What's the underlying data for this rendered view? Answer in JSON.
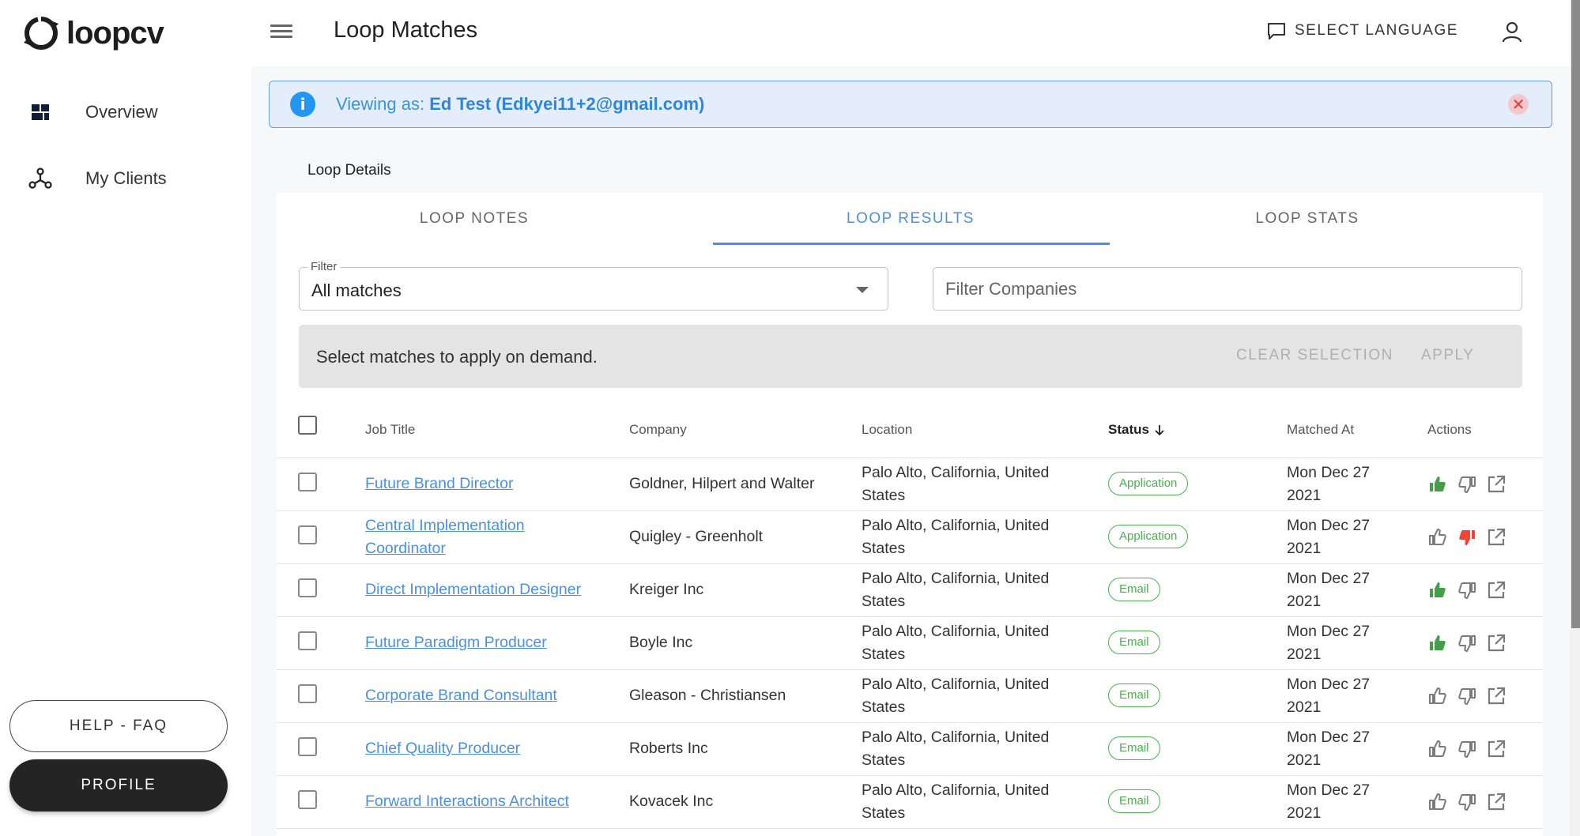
{
  "app": {
    "brand": "loopcv",
    "page_title": "Loop Matches"
  },
  "sidebar": {
    "items": [
      {
        "label": "Overview",
        "icon": "dashboard-icon"
      },
      {
        "label": "My Clients",
        "icon": "hub-icon"
      }
    ],
    "help_label": "HELP - FAQ",
    "profile_label": "PROFILE"
  },
  "header": {
    "language_label": "SELECT LANGUAGE"
  },
  "alert": {
    "prefix": "Viewing as:",
    "user": "Ed Test (Edkyei11+2@gmail.com)"
  },
  "section_label": "Loop Details",
  "tabs": [
    {
      "label": "LOOP NOTES",
      "active": false
    },
    {
      "label": "LOOP RESULTS",
      "active": true
    },
    {
      "label": "LOOP STATS",
      "active": false
    }
  ],
  "filters": {
    "filter_label": "Filter",
    "filter_value": "All matches",
    "companies_placeholder": "Filter Companies",
    "companies_value": ""
  },
  "apply_bar": {
    "text": "Select matches to apply on demand.",
    "clear_label": "CLEAR SELECTION",
    "apply_label": "APPLY"
  },
  "table": {
    "columns": [
      "Job Title",
      "Company",
      "Location",
      "Status",
      "Matched At",
      "Actions"
    ],
    "sorted_column": "Status",
    "sort_direction": "desc",
    "rows": [
      {
        "title": "Future Brand Director",
        "company": "Goldner, Hilpert and Walter",
        "location": "Palo Alto, California, United States",
        "status": "Application",
        "matched_at": "Mon Dec 27 2021",
        "vote": "up"
      },
      {
        "title": "Central Implementation Coordinator",
        "company": "Quigley - Greenholt",
        "location": "Palo Alto, California, United States",
        "status": "Application",
        "matched_at": "Mon Dec 27 2021",
        "vote": "down"
      },
      {
        "title": "Direct Implementation Designer",
        "company": "Kreiger Inc",
        "location": "Palo Alto, California, United States",
        "status": "Email",
        "matched_at": "Mon Dec 27 2021",
        "vote": "up"
      },
      {
        "title": "Future Paradigm Producer",
        "company": "Boyle Inc",
        "location": "Palo Alto, California, United States",
        "status": "Email",
        "matched_at": "Mon Dec 27 2021",
        "vote": "up"
      },
      {
        "title": "Corporate Brand Consultant",
        "company": "Gleason - Christiansen",
        "location": "Palo Alto, California, United States",
        "status": "Email",
        "matched_at": "Mon Dec 27 2021",
        "vote": "none"
      },
      {
        "title": "Chief Quality Producer",
        "company": "Roberts Inc",
        "location": "Palo Alto, California, United States",
        "status": "Email",
        "matched_at": "Mon Dec 27 2021",
        "vote": "none"
      },
      {
        "title": "Forward Interactions Architect",
        "company": "Kovacek Inc",
        "location": "Palo Alto, California, United States",
        "status": "Email",
        "matched_at": "Mon Dec 27 2021",
        "vote": "none"
      }
    ]
  },
  "colors": {
    "accent": "#4a90e2",
    "thumb_up_active": "#43a047",
    "thumb_down_active": "#f44336",
    "icon_inactive": "#7a7a7a",
    "badge": "#4caf50"
  }
}
